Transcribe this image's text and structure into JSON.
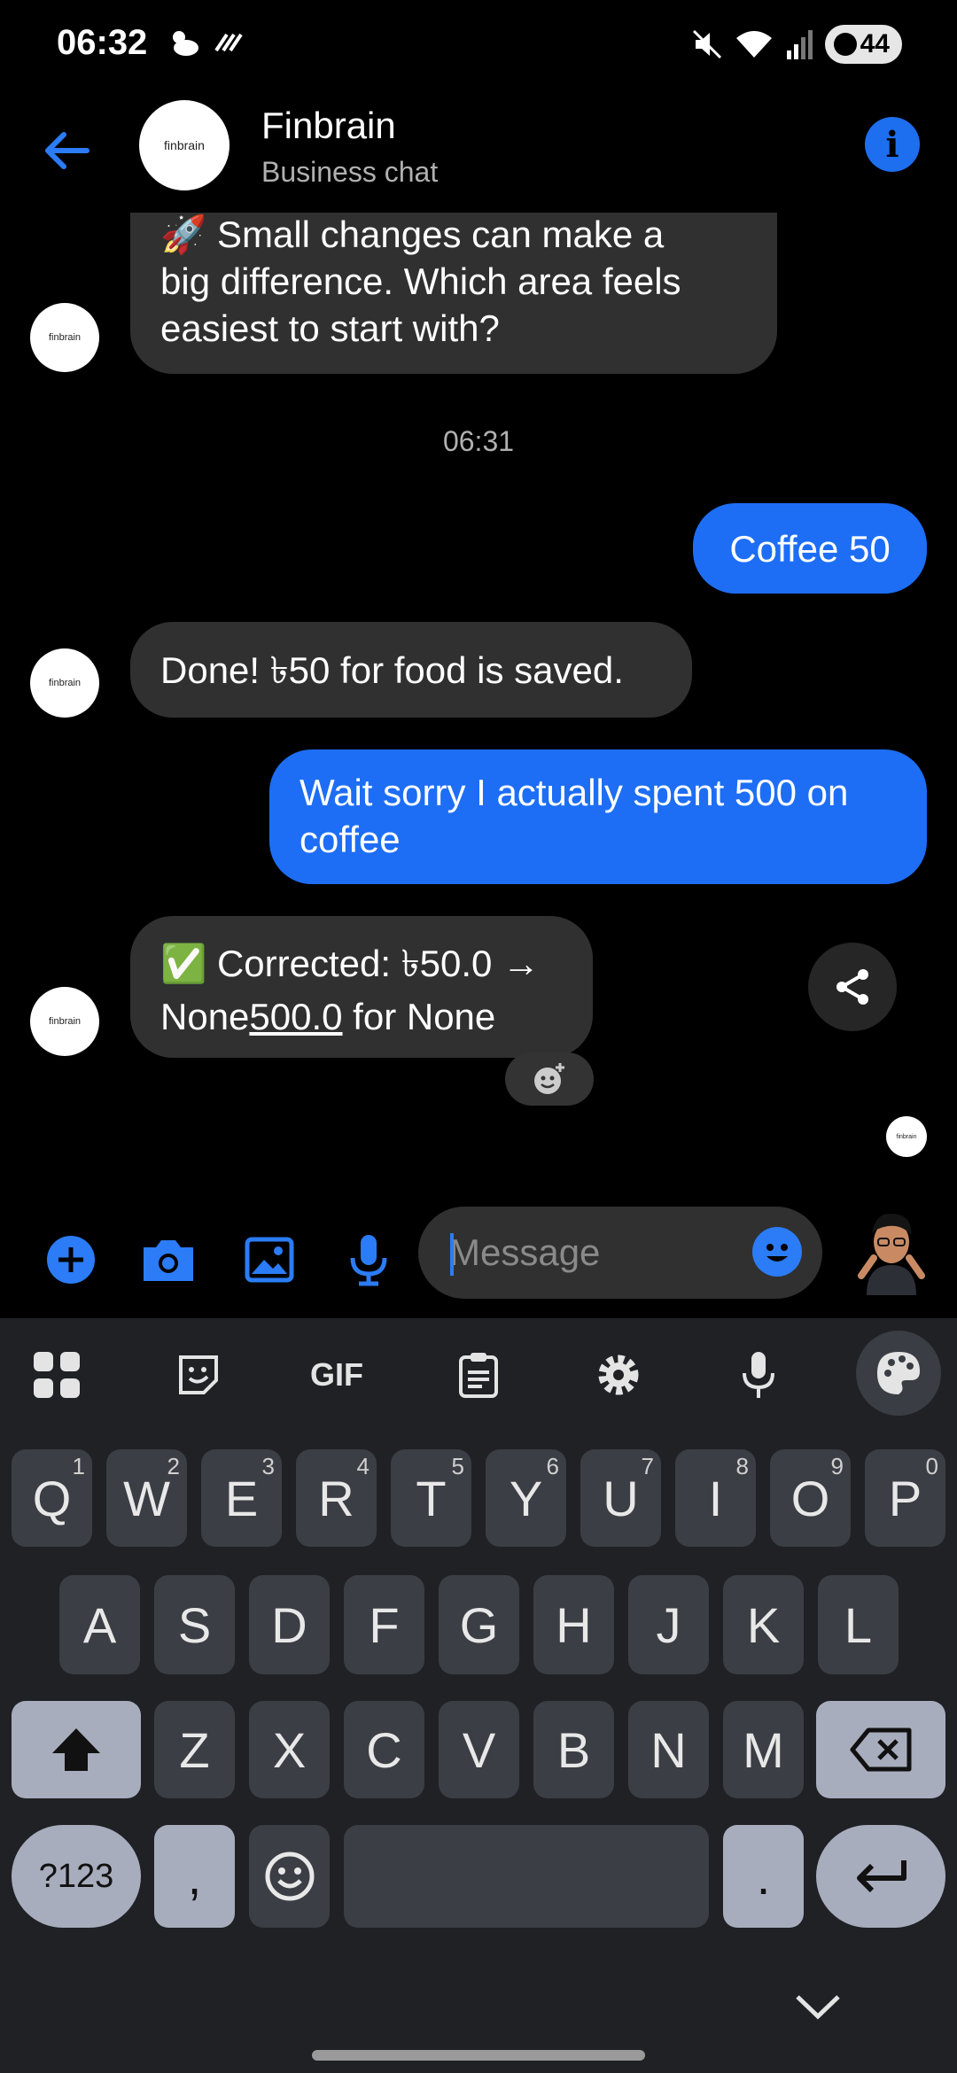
{
  "status_bar": {
    "time": "06:32",
    "battery": "44"
  },
  "header": {
    "title": "Finbrain",
    "subtitle": "Business chat",
    "avatar_text": "finbrain"
  },
  "messages": {
    "m1": {
      "lines": [
        "🚀 Small changes can make a",
        "big difference. Which area feels",
        "easiest to start with?"
      ],
      "avatar": "finbrain"
    },
    "timestamp": "06:31",
    "m2": {
      "text": "Coffee 50"
    },
    "m3": {
      "text": "Done! ৳50 for food is saved.",
      "avatar": "finbrain"
    },
    "m4": {
      "lines": [
        "Wait sorry I actually spent 500 on",
        "coffee"
      ]
    },
    "m5": {
      "line1": "✅ Corrected: ৳50.0 →",
      "line2_a": "None",
      "line2_link": "500.0",
      "line2_b": " for None",
      "avatar": "finbrain"
    }
  },
  "input": {
    "placeholder": "Message"
  },
  "keyboard": {
    "toolbar": {
      "gif_label": "GIF"
    },
    "row1": [
      {
        "k": "Q",
        "h": "1"
      },
      {
        "k": "W",
        "h": "2"
      },
      {
        "k": "E",
        "h": "3"
      },
      {
        "k": "R",
        "h": "4"
      },
      {
        "k": "T",
        "h": "5"
      },
      {
        "k": "Y",
        "h": "6"
      },
      {
        "k": "U",
        "h": "7"
      },
      {
        "k": "I",
        "h": "8"
      },
      {
        "k": "O",
        "h": "9"
      },
      {
        "k": "P",
        "h": "0"
      }
    ],
    "row2": [
      "A",
      "S",
      "D",
      "F",
      "G",
      "H",
      "J",
      "K",
      "L"
    ],
    "row3": [
      "Z",
      "X",
      "C",
      "V",
      "B",
      "N",
      "M"
    ],
    "row4": {
      "symbols": "?123",
      "comma": ",",
      "period": "."
    }
  },
  "colors": {
    "accent": "#1d6ef5",
    "incoming_bubble": "#303030",
    "keyboard_bg": "#1f2125"
  }
}
